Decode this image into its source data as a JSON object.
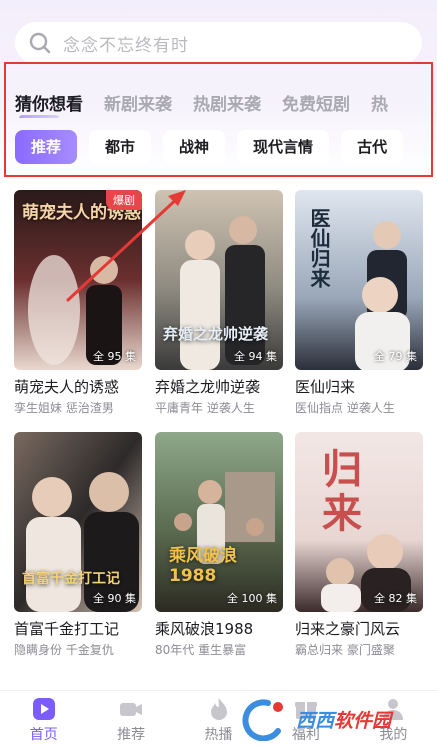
{
  "search": {
    "placeholder": "念念不忘终有时"
  },
  "tabs": [
    {
      "label": "猜你想看",
      "active": true
    },
    {
      "label": "新剧来袭"
    },
    {
      "label": "热剧来袭"
    },
    {
      "label": "免费短剧"
    },
    {
      "label": "热"
    }
  ],
  "chips": [
    {
      "label": "推荐",
      "active": true
    },
    {
      "label": "都市"
    },
    {
      "label": "战神"
    },
    {
      "label": "现代言情"
    },
    {
      "label": "古代"
    }
  ],
  "dramas": [
    {
      "title": "萌宠夫人的诱惑",
      "tags": "孪生姐妹 惩治渣男",
      "episodes": "全 95 集",
      "badge": "爆剧",
      "poster_text": "萌宠夫人的诱惑",
      "colors": [
        "#2a1a1a",
        "#6b2f2f",
        "#e9d9cf"
      ]
    },
    {
      "title": "弃婚之龙帅逆袭",
      "tags": "平庸青年 逆袭人生",
      "episodes": "全 94 集",
      "poster_text": "弃婚之龙帅逆袭",
      "colors": [
        "#cfc3b3",
        "#8e8a80",
        "#3a3a3a"
      ]
    },
    {
      "title": "医仙归来",
      "tags": "医仙指点 逆袭人生",
      "episodes": "全 79 集",
      "poster_text": "医仙归来",
      "colors": [
        "#dfe6ef",
        "#9aa7b8",
        "#2b2f3a"
      ]
    },
    {
      "title": "首富千金打工记",
      "tags": "隐瞒身份 千金复仇",
      "episodes": "全 90 集",
      "poster_text": "首富千金打工记",
      "colors": [
        "#7a6a60",
        "#2d2a2a",
        "#d9c4b4"
      ]
    },
    {
      "title": "乘风破浪1988",
      "tags": "80年代 重生暴富",
      "episodes": "全 100 集",
      "poster_text": "乘风破浪1988",
      "colors": [
        "#8fa889",
        "#5a6b4f",
        "#d9b24a"
      ]
    },
    {
      "title": "归来之豪门风云",
      "tags": "霸总归来 豪门盛聚",
      "episodes": "全 82 集",
      "poster_text": "归来",
      "colors": [
        "#f2e7e5",
        "#c94f4f",
        "#3b2b2b"
      ]
    }
  ],
  "nav": [
    {
      "label": "首页",
      "icon": "home-play-icon",
      "active": true
    },
    {
      "label": "推荐",
      "icon": "video-camera-icon"
    },
    {
      "label": "热播",
      "icon": "flame-icon"
    },
    {
      "label": "福利",
      "icon": "gift-icon"
    },
    {
      "label": "我的",
      "icon": "person-icon"
    }
  ],
  "watermark": {
    "text_blue": "西西",
    "text_red": "软件园"
  },
  "colors": {
    "accent": "#7b5cff",
    "highlight_box": "#e53935",
    "badge": "#e8454a"
  }
}
